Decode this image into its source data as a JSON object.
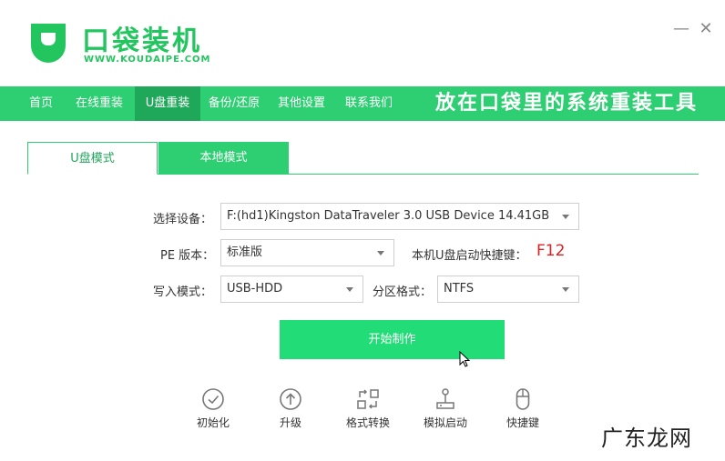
{
  "brand": {
    "name": "口袋装机",
    "url": "WWW.KOUDAIPE.COM"
  },
  "window_controls": {
    "minimize": "—",
    "close": "✕"
  },
  "nav": {
    "items": [
      {
        "label": "首页"
      },
      {
        "label": "在线重装"
      },
      {
        "label": "U盘重装"
      },
      {
        "label": "备份/还原"
      },
      {
        "label": "其他设置"
      },
      {
        "label": "联系我们"
      }
    ],
    "active_index": 2,
    "slogan": "放在口袋里的系统重装工具"
  },
  "tabs": [
    {
      "label": "U盘模式",
      "active": true
    },
    {
      "label": "本地模式",
      "active": false
    }
  ],
  "form": {
    "device_label": "选择设备：",
    "device_value": "F:(hd1)Kingston DataTraveler 3.0 USB Device 14.41GB",
    "pe_label": "PE 版本：",
    "pe_value": "标准版",
    "hotkey_label": "本机U盘启动快捷键：",
    "hotkey_value": "F12",
    "write_label": "写入模式：",
    "write_value": "USB-HDD",
    "partition_label": "分区格式：",
    "partition_value": "NTFS"
  },
  "start_button": "开始制作",
  "tools": [
    {
      "label": "初始化",
      "icon": "check-circle-icon"
    },
    {
      "label": "升级",
      "icon": "arrow-up-circle-icon"
    },
    {
      "label": "格式转换",
      "icon": "convert-icon"
    },
    {
      "label": "模拟启动",
      "icon": "joystick-icon"
    },
    {
      "label": "快捷键",
      "icon": "mouse-icon"
    }
  ],
  "watermark": "广东龙网",
  "colors": {
    "brand_green": "#2dcf72",
    "active_nav": "#1fa85a",
    "button_green": "#22dd77",
    "hotkey_red": "#e02020"
  }
}
